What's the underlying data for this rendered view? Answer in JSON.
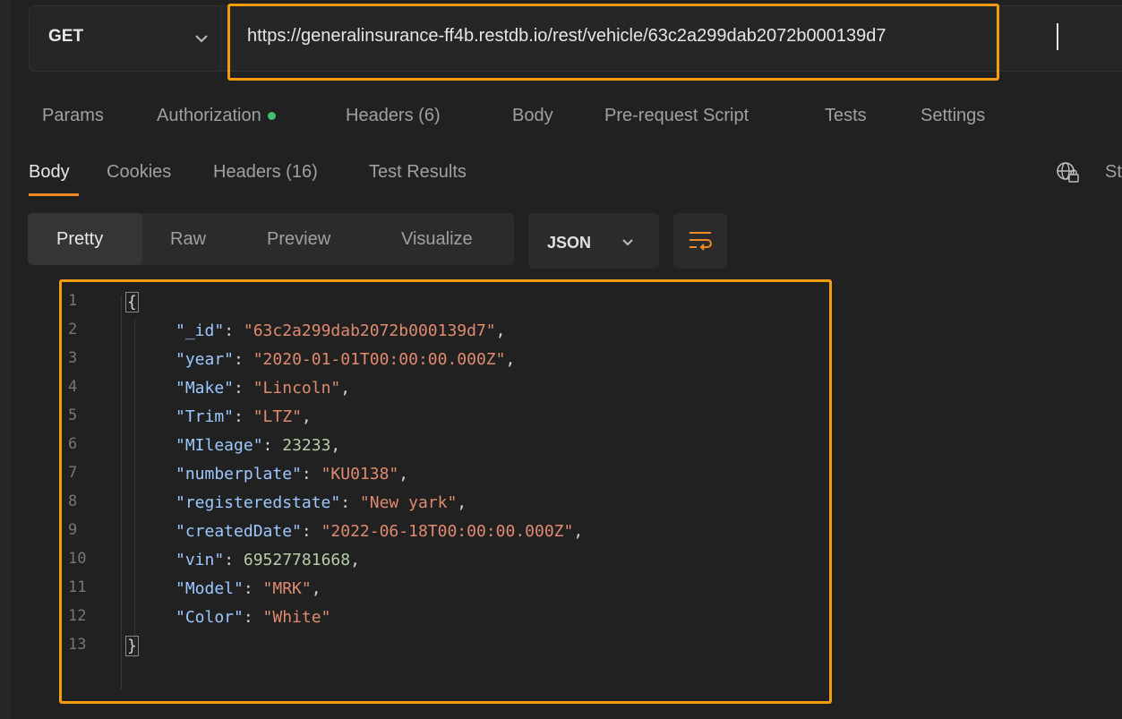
{
  "request": {
    "method": "GET",
    "url": "https://generalinsurance-ff4b.restdb.io/rest/vehicle/63c2a299dab2072b000139d7"
  },
  "request_tabs": {
    "params": "Params",
    "authorization": "Authorization",
    "headers": "Headers",
    "headers_count": "(6)",
    "body": "Body",
    "prerequest": "Pre-request Script",
    "tests": "Tests",
    "settings": "Settings"
  },
  "response_tabs": {
    "body": "Body",
    "cookies": "Cookies",
    "headers": "Headers",
    "headers_count": "(16)",
    "test_results": "Test Results",
    "status_partial": "St"
  },
  "view_tabs": {
    "pretty": "Pretty",
    "raw": "Raw",
    "preview": "Preview",
    "visualize": "Visualize"
  },
  "format": {
    "selected": "JSON"
  },
  "icons": {
    "method_dropdown": "chevron-down-icon",
    "format_dropdown": "chevron-down-icon",
    "wrap": "wrap-lines-icon",
    "network": "globe-lock-icon"
  },
  "colors": {
    "highlight": "#f39c12",
    "active_tab_underline": "#f08a24",
    "auth_dot": "#3fbf6f",
    "count_green": "#4ec9a0"
  },
  "code": {
    "line_numbers": [
      "1",
      "2",
      "3",
      "4",
      "5",
      "6",
      "7",
      "8",
      "9",
      "10",
      "11",
      "12",
      "13"
    ],
    "open_brace": "{",
    "close_brace": "}",
    "fields": [
      {
        "key": "\"_id\"",
        "value": "\"63c2a299dab2072b000139d7\"",
        "type": "string",
        "comma": ","
      },
      {
        "key": "\"year\"",
        "value": "\"2020-01-01T00:00:00.000Z\"",
        "type": "string",
        "comma": ","
      },
      {
        "key": "\"Make\"",
        "value": "\"Lincoln\"",
        "type": "string",
        "comma": ","
      },
      {
        "key": "\"Trim\"",
        "value": "\"LTZ\"",
        "type": "string",
        "comma": ","
      },
      {
        "key": "\"MIleage\"",
        "value": "23233",
        "type": "number",
        "comma": ","
      },
      {
        "key": "\"numberplate\"",
        "value": "\"KU0138\"",
        "type": "string",
        "comma": ","
      },
      {
        "key": "\"registeredstate\"",
        "value": "\"New yark\"",
        "type": "string",
        "comma": ","
      },
      {
        "key": "\"createdDate\"",
        "value": "\"2022-06-18T00:00:00.000Z\"",
        "type": "string",
        "comma": ","
      },
      {
        "key": "\"vin\"",
        "value": "69527781668",
        "type": "number",
        "comma": ","
      },
      {
        "key": "\"Model\"",
        "value": "\"MRK\"",
        "type": "string",
        "comma": ","
      },
      {
        "key": "\"Color\"",
        "value": "\"White\"",
        "type": "string",
        "comma": ""
      }
    ]
  }
}
